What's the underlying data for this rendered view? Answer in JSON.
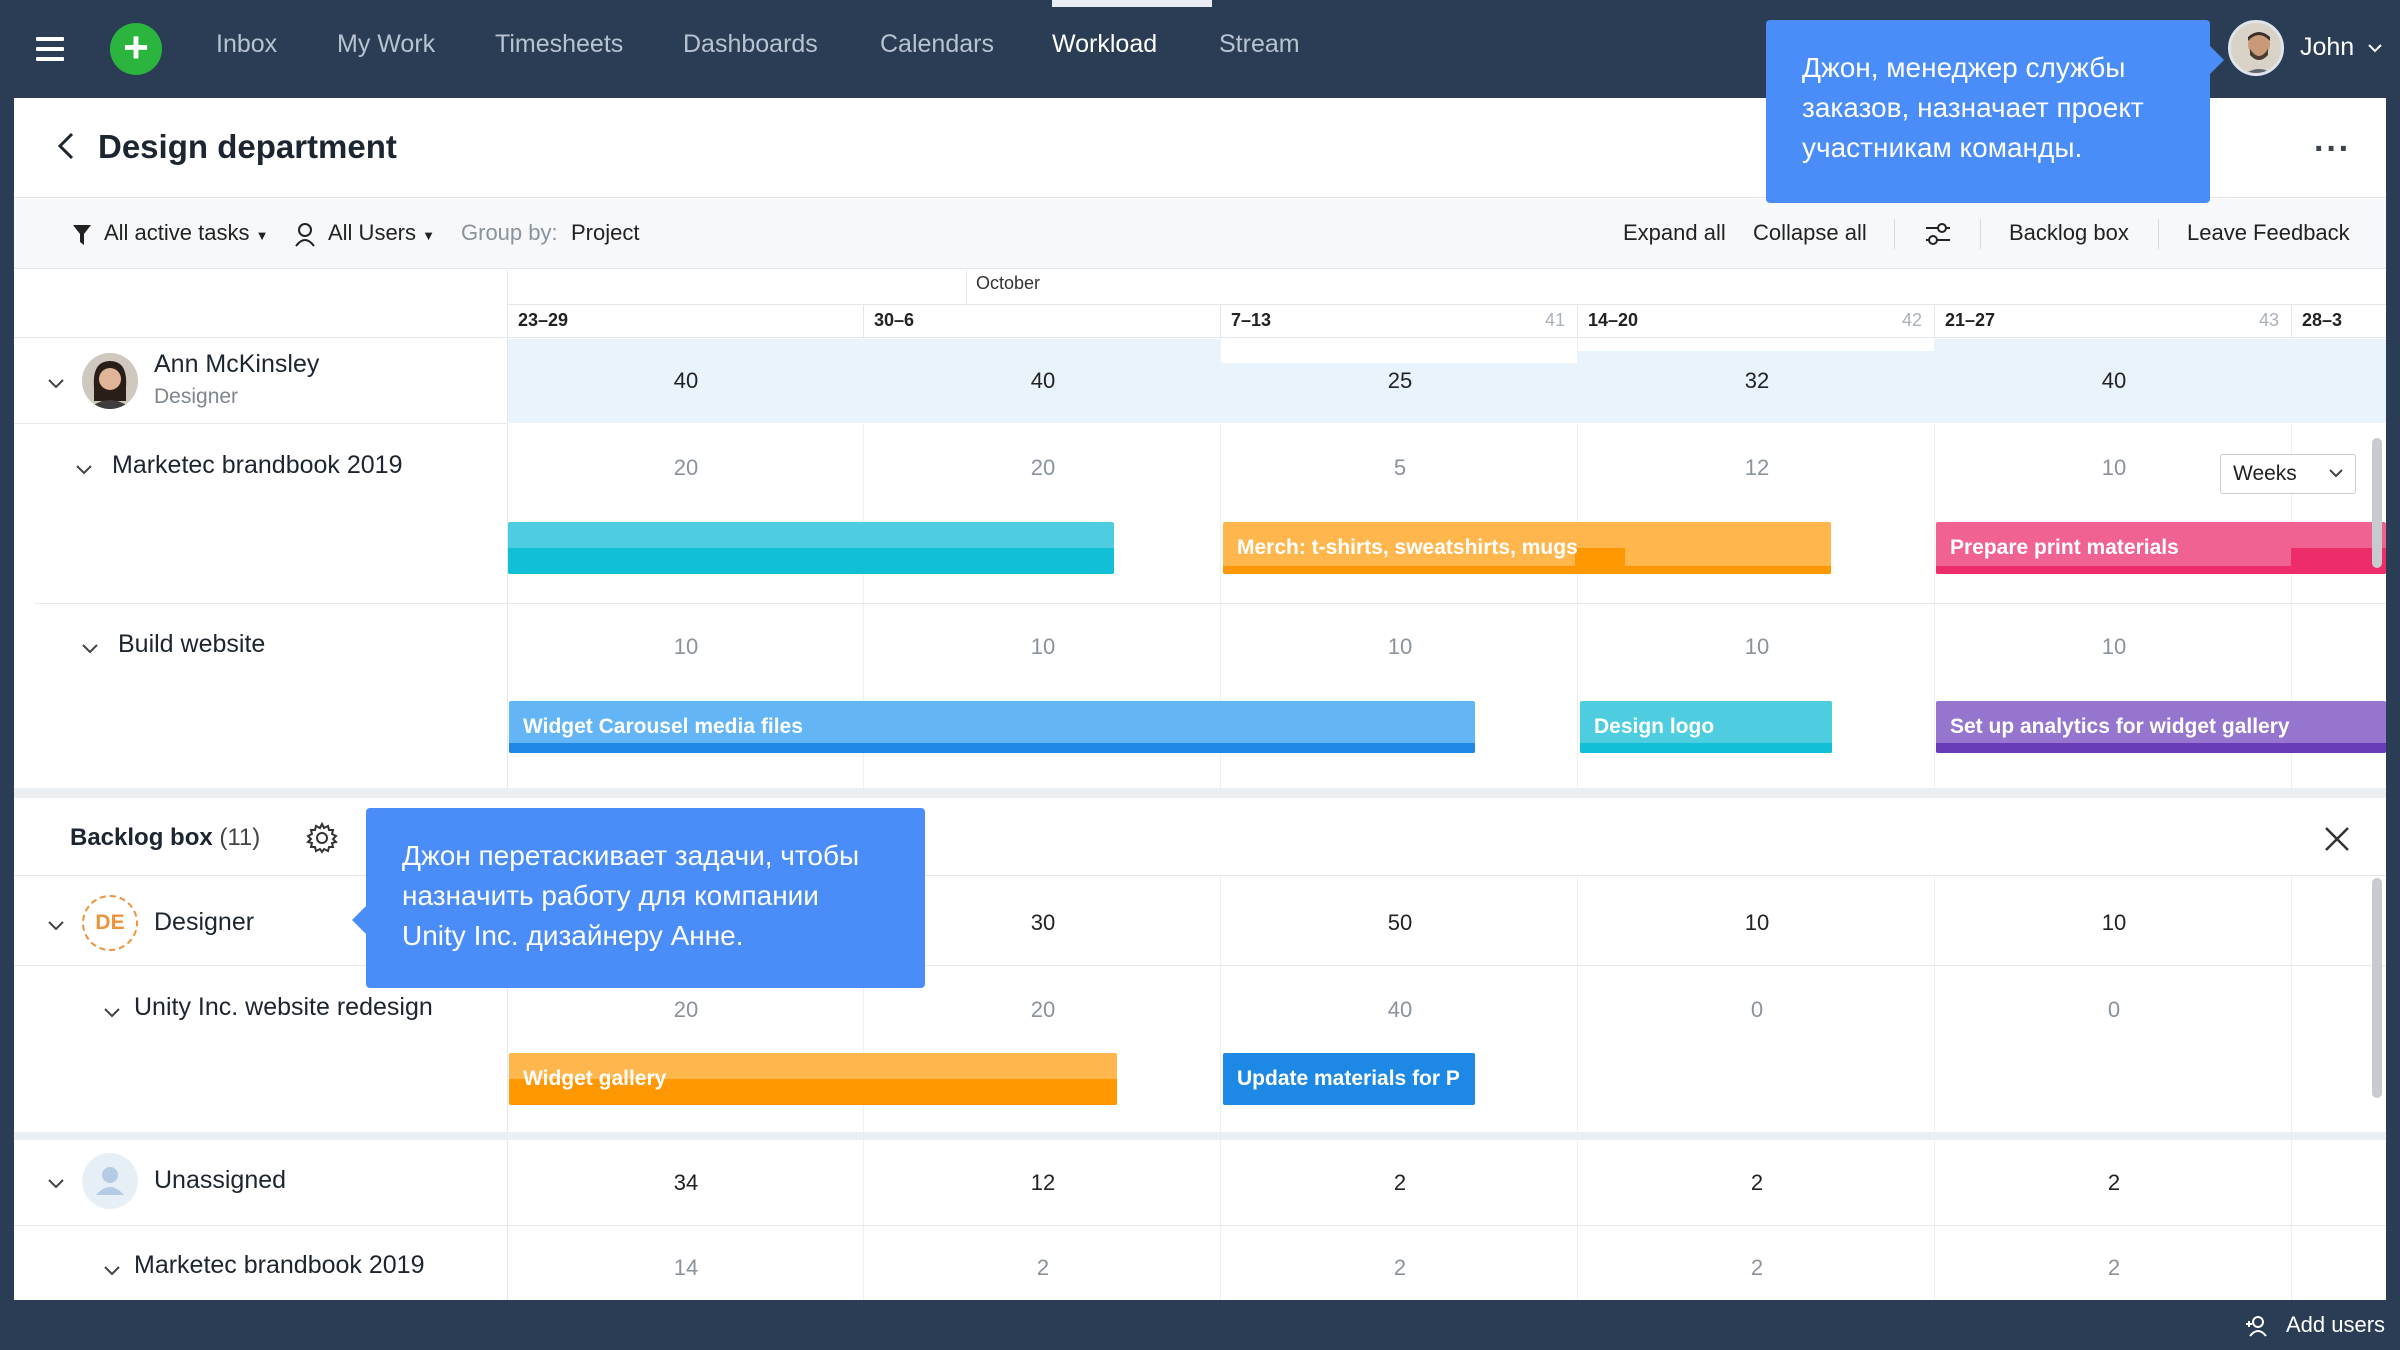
{
  "nav": {
    "items": [
      "Inbox",
      "My Work",
      "Timesheets",
      "Dashboards",
      "Calendars",
      "Workload",
      "Stream"
    ],
    "active": "Workload",
    "user_name": "John"
  },
  "header": {
    "title": "Design department"
  },
  "toolbar": {
    "filter_tasks": "All active tasks",
    "filter_users": "All Users",
    "group_by_label": "Group by:",
    "group_by_value": "Project",
    "expand_all": "Expand all",
    "collapse_all": "Collapse all",
    "backlog_box": "Backlog box",
    "leave_feedback": "Leave Feedback"
  },
  "timeline": {
    "month": "October",
    "weeks": [
      {
        "label": "23–29",
        "num": ""
      },
      {
        "label": "30–6",
        "num": ""
      },
      {
        "label": "7–13",
        "num": "41"
      },
      {
        "label": "14–20",
        "num": "42"
      },
      {
        "label": "21–27",
        "num": "43"
      },
      {
        "label": "28–3",
        "num": ""
      }
    ],
    "scale_select": "Weeks"
  },
  "ann": {
    "name": "Ann McKinsley",
    "role": "Designer",
    "loads": [
      "40",
      "40",
      "25",
      "32",
      "40"
    ],
    "projects": [
      {
        "name": "Marketec brandbook 2019",
        "loads": [
          "20",
          "20",
          "5",
          "12",
          "10"
        ],
        "tasks": [
          "Merch: t-shirts, sweatshirts, mugs",
          "Prepare print materials"
        ]
      },
      {
        "name": "Build website",
        "loads": [
          "10",
          "10",
          "10",
          "10",
          "10"
        ],
        "tasks": [
          "Widget Carousel media files",
          "Design logo",
          "Set up analytics for widget gallery"
        ]
      }
    ]
  },
  "backlog": {
    "title": "Backlog box",
    "count": "(11)",
    "designer": {
      "badge": "DE",
      "name": "Designer",
      "loads": [
        "",
        "30",
        "50",
        "10",
        "10"
      ],
      "project": {
        "name": "Unity Inc. website redesign",
        "loads": [
          "20",
          "20",
          "40",
          "0",
          "0"
        ],
        "tasks": [
          "Widget gallery",
          "Update materials for P"
        ]
      }
    },
    "unassigned": {
      "name": "Unassigned",
      "loads": [
        "34",
        "12",
        "2",
        "2",
        "2"
      ],
      "project": {
        "name": "Marketec brandbook 2019",
        "loads": [
          "14",
          "2",
          "2",
          "2",
          "2"
        ]
      }
    }
  },
  "tooltips": {
    "tip1": "Джон, менеджер службы заказов, назначает проект участникам команды.",
    "tip2": "Джон перетаскивает задачи, чтобы назначить работу для компании Unity Inc. дизайнеру Анне."
  },
  "footer": {
    "add_users": "Add users"
  },
  "colors": {
    "nav_bg": "#2b3d54",
    "accent_green": "#2bb53f",
    "tooltip_blue": "#4a8df8",
    "cyan": "#4fcde0",
    "cyan_dark": "#11bfd6",
    "orange": "#ffb74d",
    "orange_dark": "#ff9800",
    "pink": "#f06292",
    "pink_dark": "#ec2d6a",
    "blue": "#64b5f6",
    "blue_dark": "#1e88e5",
    "purple": "#9575cd",
    "purple_dark": "#6a3bb8"
  }
}
